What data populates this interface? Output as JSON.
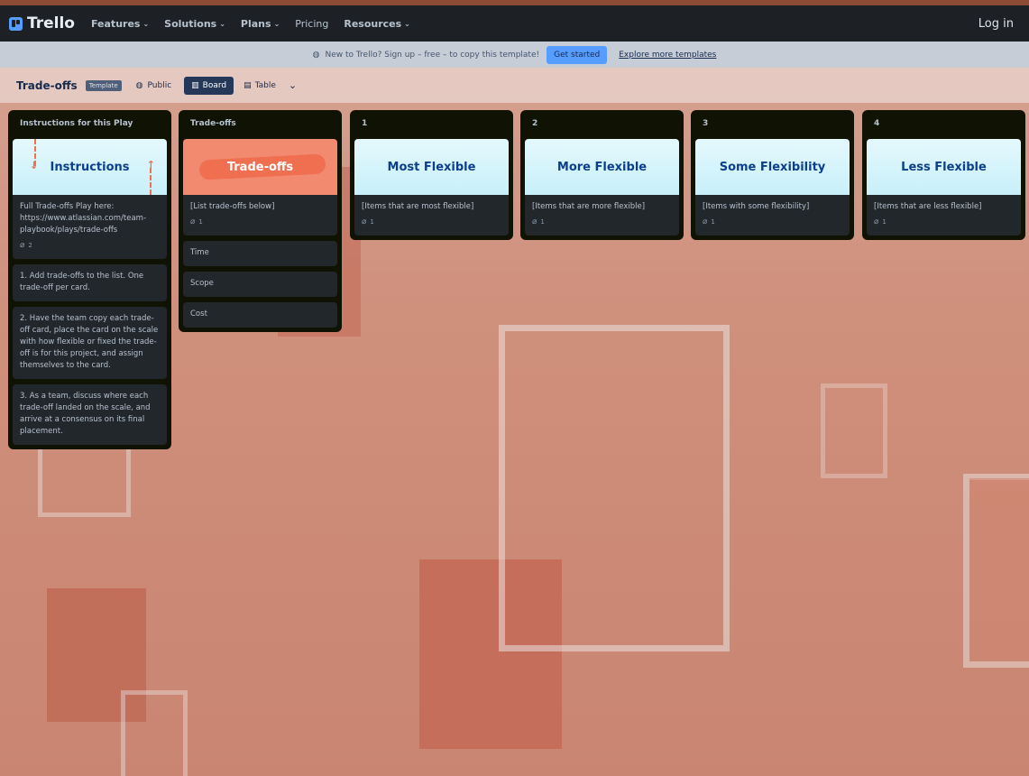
{
  "nav": {
    "logo": "Trello",
    "items": [
      {
        "label": "Features",
        "has_dropdown": true
      },
      {
        "label": "Solutions",
        "has_dropdown": true
      },
      {
        "label": "Plans",
        "has_dropdown": true
      },
      {
        "label": "Pricing",
        "has_dropdown": false
      },
      {
        "label": "Resources",
        "has_dropdown": true
      }
    ],
    "login": "Log in"
  },
  "banner": {
    "text": "New to Trello? Sign up – free – to copy this template!",
    "button": "Get started",
    "link": "Explore more templates"
  },
  "board": {
    "title": "Trade-offs",
    "badge": "Template",
    "visibility": "Public",
    "views": [
      "Board",
      "Table"
    ],
    "active_view": "Board"
  },
  "lists": [
    {
      "title": "Instructions for this Play",
      "cards": [
        {
          "cover": "Instructions",
          "text": "Full Trade-offs Play here: https://www.atlassian.com/team-playbook/plays/trade-offs",
          "attachments": "2"
        },
        {
          "text": "1. Add trade-offs to the list. One trade-off per card."
        },
        {
          "text": "2. Have the team copy each trade-off card, place the card on the scale with how flexible or fixed the trade-off is for this project, and assign themselves to the card."
        },
        {
          "text": "3. As a team, discuss where each trade-off landed on the scale, and arrive at a consensus on its final placement."
        }
      ]
    },
    {
      "title": "Trade-offs",
      "cards": [
        {
          "cover": "Trade-offs",
          "text": "[List trade-offs below]",
          "attachments": "1"
        },
        {
          "text": "Time"
        },
        {
          "text": "Scope"
        },
        {
          "text": "Cost"
        }
      ]
    },
    {
      "title": "1",
      "cards": [
        {
          "cover": "Most Flexible",
          "text": "[Items that are most flexible]",
          "attachments": "1"
        }
      ]
    },
    {
      "title": "2",
      "cards": [
        {
          "cover": "More Flexible",
          "text": "[Items that are more flexible]",
          "attachments": "1"
        }
      ]
    },
    {
      "title": "3",
      "cards": [
        {
          "cover": "Some Flexibility",
          "text": "[Items with some flexibility]",
          "attachments": "1"
        }
      ]
    },
    {
      "title": "4",
      "cards": [
        {
          "cover": "Less Flexible",
          "text": "[Items that are less flexible]",
          "attachments": "1"
        }
      ]
    }
  ],
  "icons": {
    "globe": "globe-icon",
    "board": "board-icon",
    "table": "table-icon",
    "chevron": "chevron-down-icon",
    "attachment": "paperclip-icon"
  },
  "colors": {
    "accent": "#579dff",
    "list_bg": "#101204",
    "card_bg": "#22272b",
    "cover_orange": "#f28a70",
    "cover_blue_text": "#0c3f8c"
  }
}
